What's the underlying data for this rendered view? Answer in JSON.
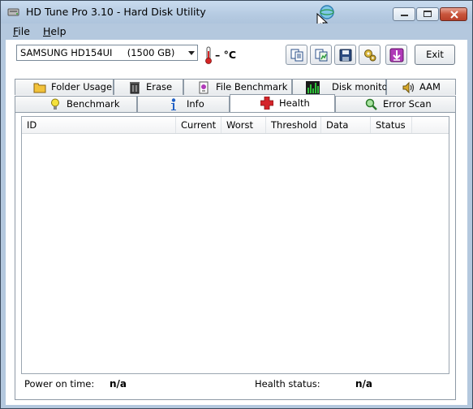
{
  "window": {
    "title": "HD Tune Pro 3.10 - Hard Disk Utility"
  },
  "menu": [
    {
      "label": "File",
      "mnemonic": "F",
      "rest": "ile"
    },
    {
      "label": "Help",
      "mnemonic": "H",
      "rest": "elp"
    }
  ],
  "toolbar": {
    "drive": "SAMSUNG HD154UI     (1500 GB)",
    "temperature": "– °C",
    "exit_label": "Exit",
    "buttons": [
      "copy-text-icon",
      "copy-screenshot-icon",
      "save-icon",
      "options-icon",
      "download-icon"
    ]
  },
  "tabs_top": [
    "Folder Usage",
    "Erase",
    "File Benchmark",
    "Disk monitor",
    "AAM"
  ],
  "tabs_bottom": [
    "Benchmark",
    "Info",
    "Health",
    "Error Scan"
  ],
  "active_tab": "Health",
  "table": {
    "columns": [
      "ID",
      "Current",
      "Worst",
      "Threshold",
      "Data",
      "Status"
    ],
    "rows": []
  },
  "footer": {
    "power_on_label": "Power on time:",
    "power_on_value": "n/a",
    "health_label": "Health status:",
    "health_value": "n/a"
  },
  "colors": {
    "titlebar": "#b6cbe2",
    "frame": "#b4c8de",
    "close": "#c9553c",
    "health_cross": "#d4242a",
    "download": "#b03ab8"
  }
}
